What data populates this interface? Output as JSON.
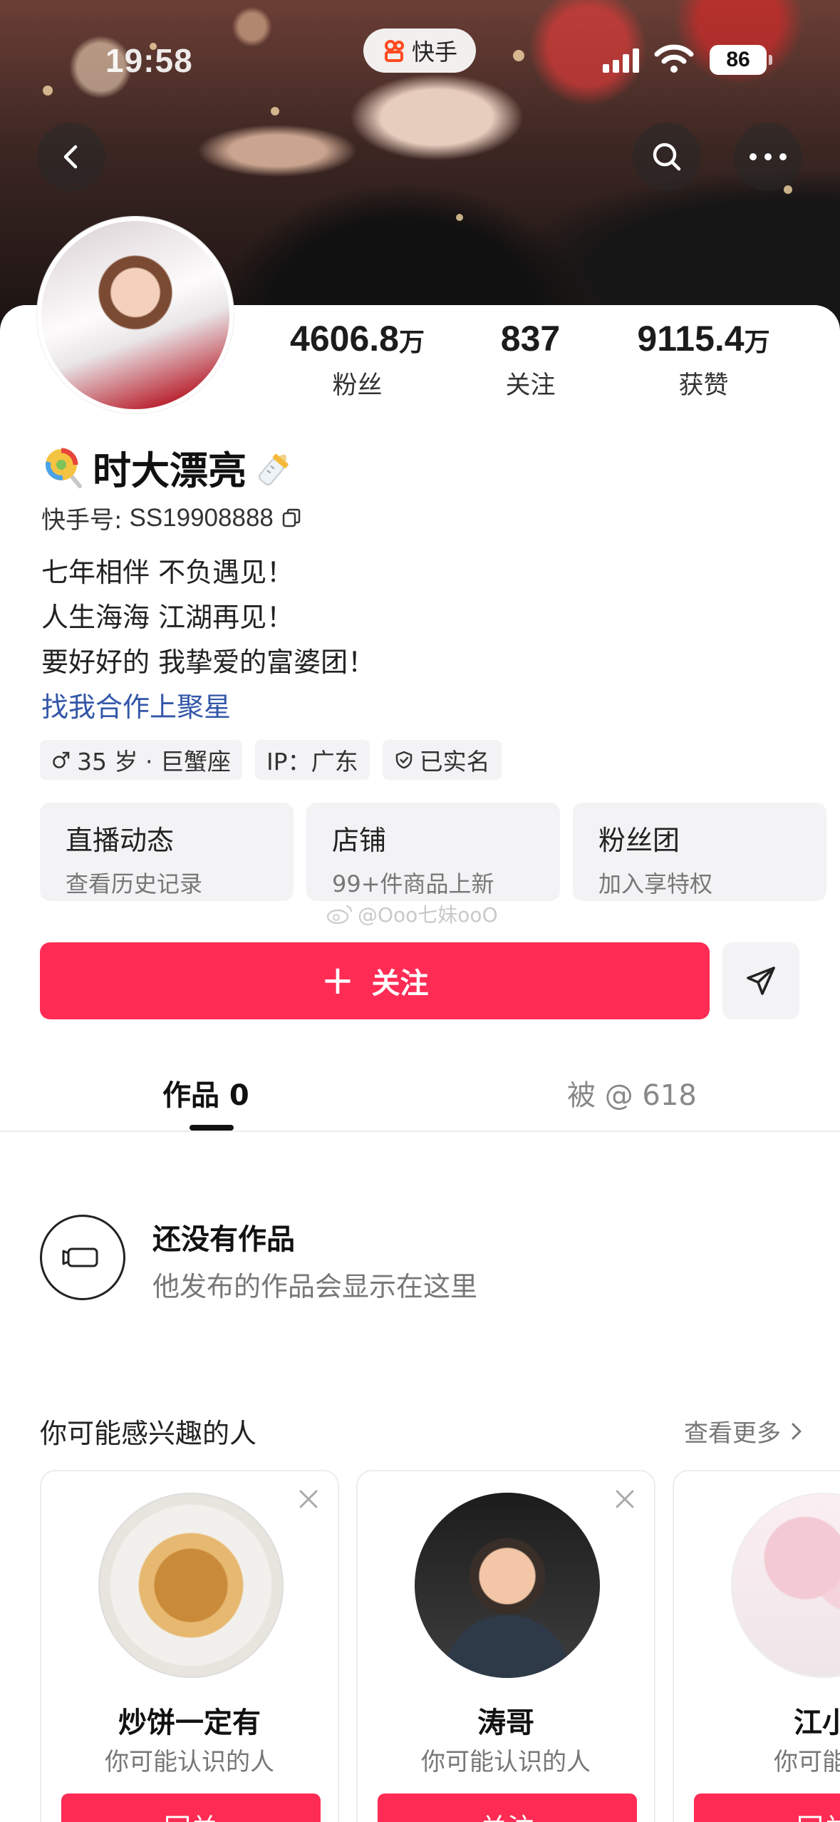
{
  "status_bar": {
    "time": "19:58",
    "app_name": "快手",
    "battery": "86"
  },
  "profile": {
    "name": "时大漂亮",
    "id_label": "快手号:",
    "id_value": "SS19908888",
    "stats": [
      {
        "value": "4606.8",
        "unit": "万",
        "label": "粉丝"
      },
      {
        "value": "837",
        "unit": "",
        "label": "关注"
      },
      {
        "value": "9115.4",
        "unit": "万",
        "label": "获赞"
      }
    ],
    "bio_lines": [
      "七年相伴 不负遇见！",
      "人生海海 江湖再见！",
      "要好好的 我挚爱的富婆团！"
    ],
    "bio_link": "找我合作上聚星",
    "tags": {
      "age": "35 岁 · 巨蟹座",
      "ip": "IP：广东",
      "verified": "已实名"
    }
  },
  "feature_cards": [
    {
      "title": "直播动态",
      "subtitle": "查看历史记录"
    },
    {
      "title": "店铺",
      "subtitle": "99+件商品上新"
    },
    {
      "title": "粉丝团",
      "subtitle": "加入享特权"
    }
  ],
  "watermark": "@Ooo七妹ooO",
  "actions": {
    "follow": "关注"
  },
  "tabs": [
    {
      "label": "作品 0"
    },
    {
      "label": "被 @ 618"
    }
  ],
  "empty_state": {
    "title": "还没有作品",
    "subtitle": "他发布的作品会显示在这里"
  },
  "recommend": {
    "title": "你可能感兴趣的人",
    "more": "查看更多",
    "users": [
      {
        "name": "炒饼一定有",
        "subtitle": "你可能认识的人",
        "button": "回关"
      },
      {
        "name": "涛哥",
        "subtitle": "你可能认识的人",
        "button": "关注"
      },
      {
        "name": "江小",
        "subtitle": "你可能认",
        "button": "回关"
      }
    ]
  },
  "colors": {
    "accent": "#fe2c55",
    "link": "#3256a8"
  }
}
